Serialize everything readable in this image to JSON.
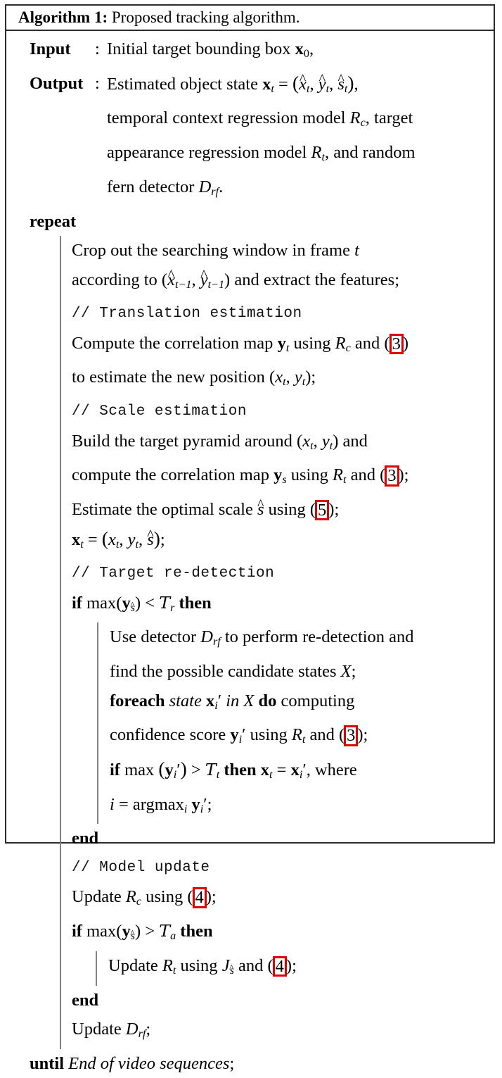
{
  "title": {
    "label": "Algorithm 1:",
    "caption": "Proposed tracking algorithm."
  },
  "io": {
    "input_key": "Input",
    "input_sep": ":",
    "input_text_a": "Initial target bounding box ",
    "input_text_b": ",",
    "output_key": "Output",
    "output_sep": ":",
    "output_line1_a": "Estimated object state ",
    "output_line1_b": " = ",
    "output_line1_c": ",",
    "output_line2_a": "temporal context regression model ",
    "output_line2_b": ", target",
    "output_line3_a": "appearance regression model ",
    "output_line3_b": ", and random",
    "output_line4_a": "fern detector ",
    "output_line4_b": "."
  },
  "body": {
    "repeat": "repeat",
    "line_crop_a": "Crop out the searching window in frame ",
    "line_according_a": "according to ",
    "line_according_b": " and extract the features;",
    "comment_translation": "// Translation estimation",
    "line_compute_a": "Compute the correlation map ",
    "line_compute_b": " using ",
    "line_compute_c": " and (",
    "line_compute_ref": "3",
    "line_compute_d": ")",
    "line_estimate_pos_a": "to estimate the new position ",
    "line_estimate_pos_b": ";",
    "comment_scale": "// Scale estimation",
    "line_build_a": "Build the target pyramid around ",
    "line_build_b": " and",
    "line_compute2_a": "compute the correlation map ",
    "line_compute2_b": " using ",
    "line_compute2_c": " and (",
    "line_compute2_ref": "3",
    "line_compute2_d": ");",
    "line_optscale_a": "Estimate the optimal scale ",
    "line_optscale_b": " using (",
    "line_optscale_ref": "5",
    "line_optscale_c": ");",
    "line_xt_assign": ";",
    "comment_redetect": "// Target re-detection",
    "if_r_kw": "if",
    "if_r_then": "then",
    "line_usedet_a": "Use detector ",
    "line_usedet_b": " to perform re-detection and",
    "line_find_a": "find the possible candidate states ",
    "line_find_b": ";",
    "foreach_kw": "foreach",
    "foreach_state": "state",
    "foreach_in": "in",
    "foreach_do": "do",
    "foreach_tail": "computing",
    "line_conf_a": "confidence score ",
    "line_conf_b": " using ",
    "line_conf_c": " and (",
    "line_conf_ref": "3",
    "line_conf_d": ");",
    "if_t_kw": "if",
    "if_t_then": "then",
    "if_t_where": ", where",
    "line_argmax_eq": " = argmax",
    "line_argmax_end": ";",
    "end_1": "end",
    "comment_model": "// Model update",
    "line_updrc_a": "Update ",
    "line_updrc_b": " using (",
    "line_updrc_ref": "4",
    "line_updrc_c": ");",
    "if_a_kw": "if",
    "if_a_then": "then",
    "line_updrt_a": "Update ",
    "line_updrt_b": " using ",
    "line_updrt_c": " and (",
    "line_updrt_ref": "4",
    "line_updrt_d": ");",
    "end_2": "end",
    "line_upddrf_a": "Update ",
    "line_upddrf_b": ";",
    "until_kw": "until",
    "until_text": "End of video sequences",
    "until_end": ";"
  },
  "colors": {
    "ref_highlight": "#e00000",
    "indent_bar": "#808080",
    "frame": "#2b2b2b"
  }
}
